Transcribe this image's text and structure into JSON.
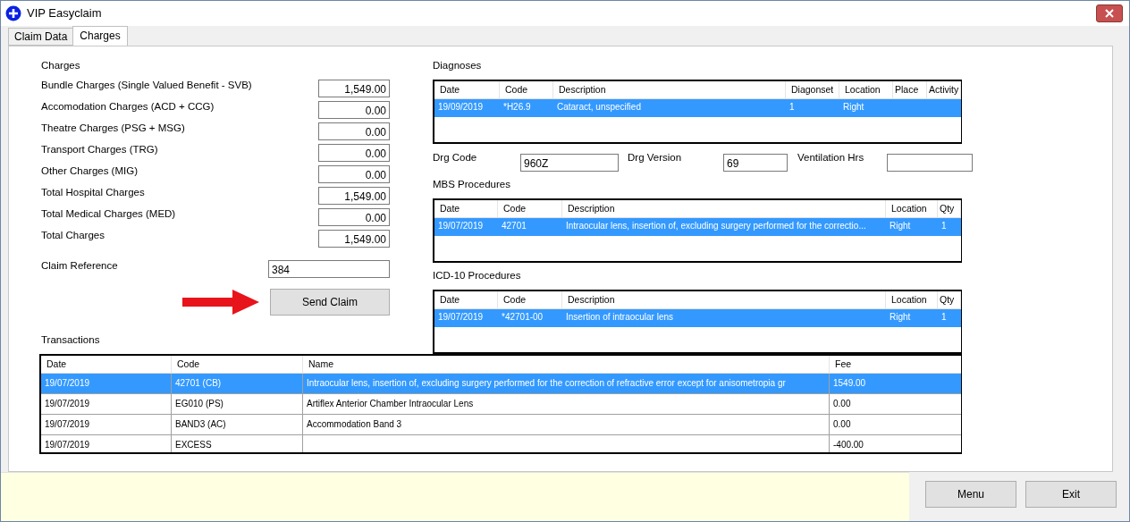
{
  "window": {
    "title": "VIP Easyclaim"
  },
  "tabs": [
    {
      "label": "Claim Data",
      "selected": false
    },
    {
      "label": "Charges",
      "selected": true
    }
  ],
  "charges": {
    "title": "Charges",
    "rows": [
      {
        "label": "Bundle Charges (Single Valued Benefit - SVB)",
        "value": "1,549.00"
      },
      {
        "label": "Accomodation Charges (ACD + CCG)",
        "value": "0.00"
      },
      {
        "label": "Theatre Charges (PSG + MSG)",
        "value": "0.00"
      },
      {
        "label": "Transport Charges (TRG)",
        "value": "0.00"
      },
      {
        "label": "Other Charges (MIG)",
        "value": "0.00"
      },
      {
        "label": "Total Hospital Charges",
        "value": "1,549.00"
      },
      {
        "label": "Total Medical Charges (MED)",
        "value": "0.00"
      },
      {
        "label": "Total Charges",
        "value": "1,549.00"
      }
    ]
  },
  "claim_reference": {
    "label": "Claim Reference",
    "value": "384"
  },
  "send_button": "Send Claim",
  "diagnoses": {
    "title": "Diagnoses",
    "columns": [
      "Date",
      "Code",
      "Description",
      "Diagonset",
      "Location",
      "Place",
      "Activity"
    ],
    "rows": [
      {
        "selected": true,
        "cells": [
          "19/09/2019",
          "*H26.9",
          "Cataract, unspecified",
          "1",
          "Right",
          "",
          ""
        ]
      }
    ]
  },
  "drg": [
    {
      "label": "Drg Code",
      "value": "960Z"
    },
    {
      "label": "Drg Version",
      "value": "69"
    },
    {
      "label": "Ventilation Hrs"
    }
  ],
  "mbs_procedures": {
    "title": "MBS Procedures",
    "columns": [
      "Date",
      "Code",
      "Description",
      "Location",
      "Qty"
    ],
    "rows": [
      {
        "selected": true,
        "cells": [
          "19/07/2019",
          "42701",
          "Intraocular lens, insertion of, excluding surgery performed for the correctio...",
          "Right",
          "1"
        ]
      }
    ]
  },
  "icd10_procedures": {
    "title": "ICD-10 Procedures",
    "columns": [
      "Date",
      "Code",
      "Description",
      "Location",
      "Qty"
    ],
    "rows": [
      {
        "selected": true,
        "cells": [
          "19/07/2019",
          "*42701-00",
          "Insertion of intraocular lens",
          "Right",
          "1"
        ]
      }
    ]
  },
  "transactions": {
    "title": "Transactions",
    "columns": [
      "Date",
      "Code",
      "Name",
      "Fee"
    ],
    "rows": [
      {
        "selected": true,
        "cells": [
          "19/07/2019",
          "42701 (CB)",
          "Intraocular lens, insertion of, excluding surgery performed for the correction of refractive error  except for anisometropia gr",
          "1549.00"
        ]
      },
      {
        "selected": false,
        "cells": [
          "19/07/2019",
          "EG010 (PS)",
          "Artiflex Anterior Chamber Intraocular Lens",
          "0.00"
        ]
      },
      {
        "selected": false,
        "cells": [
          "19/07/2019",
          "BAND3 (AC)",
          "Accommodation Band 3",
          "0.00"
        ]
      },
      {
        "selected": false,
        "cells": [
          "19/07/2019",
          "EXCESS",
          "",
          "-400.00"
        ]
      }
    ]
  },
  "footer_buttons": [
    "Menu",
    "Exit"
  ]
}
